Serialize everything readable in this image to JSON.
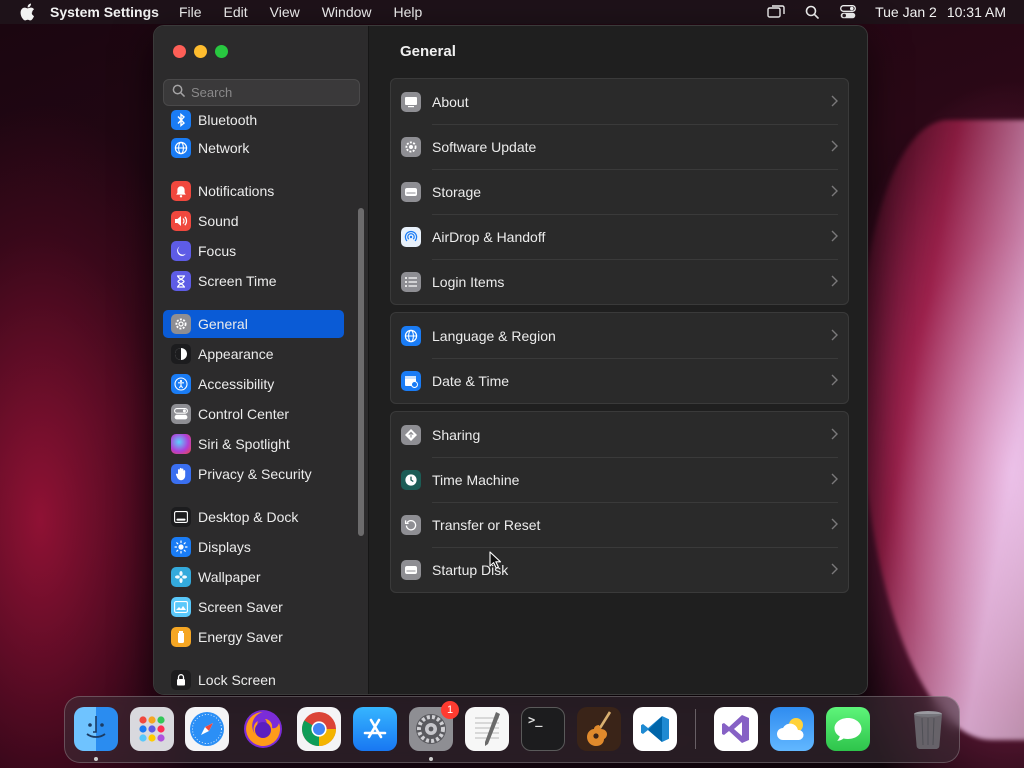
{
  "menubar": {
    "app_name": "System Settings",
    "menus": [
      "File",
      "Edit",
      "View",
      "Window",
      "Help"
    ],
    "date": "Tue Jan 2",
    "time": "10:31 AM"
  },
  "sidebar": {
    "search_placeholder": "Search",
    "items": [
      {
        "label": "Bluetooth",
        "icon": "bluetooth-icon",
        "color": "#1a7cf5"
      },
      {
        "label": "Network",
        "icon": "globe-icon",
        "color": "#1a7cf5"
      },
      {
        "label": "Notifications",
        "icon": "bell-icon",
        "color": "#f0483e"
      },
      {
        "label": "Sound",
        "icon": "speaker-icon",
        "color": "#f0483e"
      },
      {
        "label": "Focus",
        "icon": "moon-icon",
        "color": "#5e5ce6"
      },
      {
        "label": "Screen Time",
        "icon": "hourglass-icon",
        "color": "#5e5ce6"
      },
      {
        "label": "General",
        "icon": "gear-icon",
        "color": "#8e8e93",
        "selected": true
      },
      {
        "label": "Appearance",
        "icon": "appearance-icon",
        "color": "#1c1c1e"
      },
      {
        "label": "Accessibility",
        "icon": "accessibility-icon",
        "color": "#1a7cf5"
      },
      {
        "label": "Control Center",
        "icon": "toggles-icon",
        "color": "#8e8e93"
      },
      {
        "label": "Siri & Spotlight",
        "icon": "siri-icon",
        "color": "#b03fd8"
      },
      {
        "label": "Privacy & Security",
        "icon": "hand-icon",
        "color": "#3a6ff0"
      },
      {
        "label": "Desktop & Dock",
        "icon": "dock-icon",
        "color": "#1c1c1e"
      },
      {
        "label": "Displays",
        "icon": "sun-icon",
        "color": "#1a7cf5"
      },
      {
        "label": "Wallpaper",
        "icon": "flower-icon",
        "color": "#34aadc"
      },
      {
        "label": "Screen Saver",
        "icon": "screensaver-icon",
        "color": "#5ac8fa"
      },
      {
        "label": "Energy Saver",
        "icon": "battery-icon",
        "color": "#f5a623"
      },
      {
        "label": "Lock Screen",
        "icon": "lock-icon",
        "color": "#1c1c1e"
      }
    ]
  },
  "main": {
    "title": "General",
    "groups": [
      [
        {
          "label": "About",
          "icon": "computer-icon",
          "color": "#8e8e93"
        },
        {
          "label": "Software Update",
          "icon": "gear-badge-icon",
          "color": "#8e8e93"
        },
        {
          "label": "Storage",
          "icon": "drive-icon",
          "color": "#8e8e93"
        },
        {
          "label": "AirDrop & Handoff",
          "icon": "airdrop-icon",
          "color": "#1a7cf5"
        },
        {
          "label": "Login Items",
          "icon": "list-icon",
          "color": "#8e8e93"
        }
      ],
      [
        {
          "label": "Language & Region",
          "icon": "globe-icon",
          "color": "#1a7cf5"
        },
        {
          "label": "Date & Time",
          "icon": "calendar-clock-icon",
          "color": "#1a7cf5"
        }
      ],
      [
        {
          "label": "Sharing",
          "icon": "sharing-icon",
          "color": "#8e8e93"
        },
        {
          "label": "Time Machine",
          "icon": "time-machine-icon",
          "color": "#1c5c55"
        },
        {
          "label": "Transfer or Reset",
          "icon": "reset-icon",
          "color": "#8e8e93"
        },
        {
          "label": "Startup Disk",
          "icon": "drive-icon",
          "color": "#8e8e93"
        }
      ]
    ]
  },
  "dock": {
    "apps": [
      {
        "name": "Finder",
        "icon": "finder-icon",
        "running": true
      },
      {
        "name": "Launchpad",
        "icon": "launchpad-icon"
      },
      {
        "name": "Safari",
        "icon": "safari-icon"
      },
      {
        "name": "Firefox",
        "icon": "firefox-icon"
      },
      {
        "name": "Chrome",
        "icon": "chrome-icon"
      },
      {
        "name": "App Store",
        "icon": "app-store-icon"
      },
      {
        "name": "System Settings",
        "icon": "system-settings-icon",
        "running": true,
        "badge": "1"
      },
      {
        "name": "TextEdit",
        "icon": "textedit-icon"
      },
      {
        "name": "Terminal",
        "icon": "terminal-icon",
        "glyph": ">_"
      },
      {
        "name": "GarageBand",
        "icon": "guitar-icon"
      },
      {
        "name": "VS Code",
        "icon": "vscode-icon"
      },
      {
        "name": "Visual Studio",
        "icon": "visual-studio-icon"
      },
      {
        "name": "Weather",
        "icon": "weather-icon"
      },
      {
        "name": "Messages",
        "icon": "messages-icon"
      },
      {
        "name": "Trash",
        "icon": "trash-icon"
      }
    ]
  }
}
